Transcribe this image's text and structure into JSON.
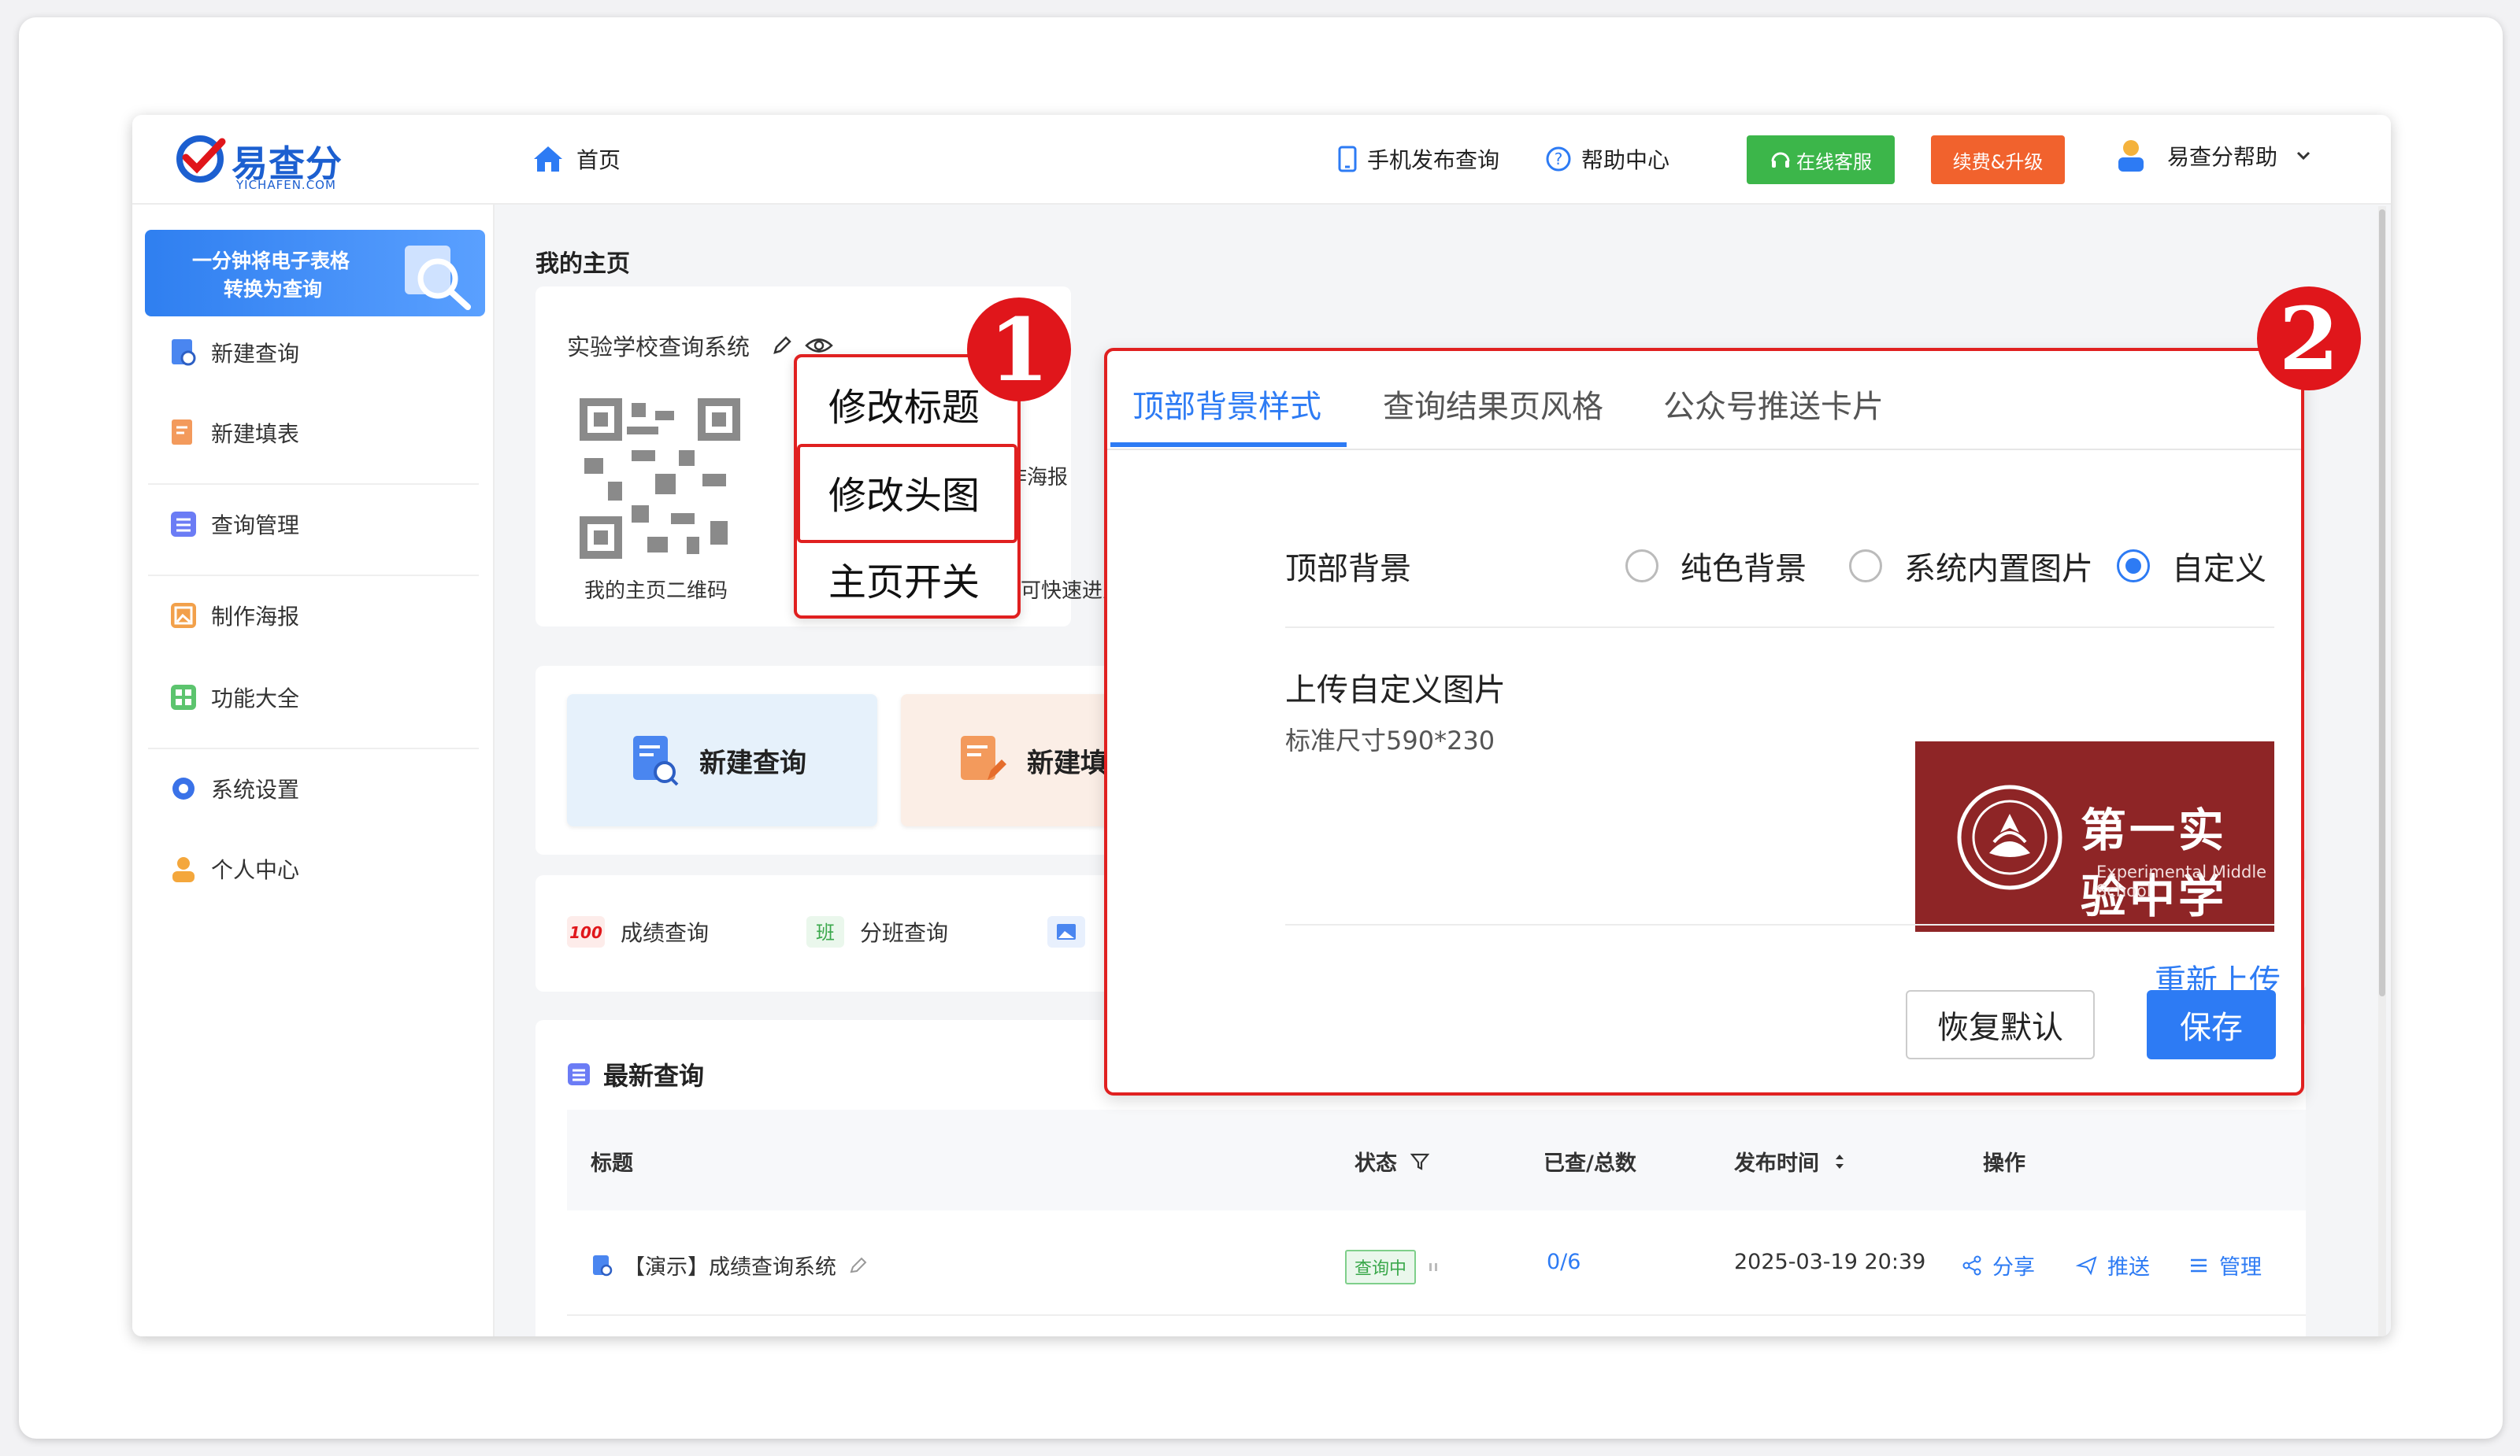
{
  "header": {
    "logo_text": "易查分",
    "logo_sub": "YICHAFEN.COM",
    "home": "首页",
    "mobile_publish": "手机发布查询",
    "help_center": "帮助中心",
    "online_service": "在线客服",
    "renew_upgrade": "续费&升级",
    "user_name": "易查分帮助"
  },
  "sidebar": {
    "banner_line1": "一分钟将电子表格",
    "banner_line2": "转换为查询",
    "items": [
      {
        "label": "新建查询"
      },
      {
        "label": "新建填表"
      },
      {
        "label": "查询管理"
      },
      {
        "label": "制作海报"
      },
      {
        "label": "功能大全"
      },
      {
        "label": "系统设置"
      },
      {
        "label": "个人中心"
      }
    ]
  },
  "main": {
    "page_title": "我的主页",
    "homepage_title": "实验学校查询系统",
    "qr_caption": "我的主页二维码",
    "partial_poster": "作海报",
    "partial_quick": "可快速进入",
    "quick_new_query": "新建查询",
    "quick_new_form": "新建填",
    "features": [
      {
        "label": "成绩查询"
      },
      {
        "label": "分班查询"
      }
    ],
    "latest_title": "最新查询",
    "table": {
      "headers": [
        "标题",
        "状态",
        "已查/总数",
        "发布时间",
        "操作"
      ],
      "rows": [
        {
          "title": "【演示】成绩查询系统",
          "status": "查询中",
          "count": "0/6",
          "time": "2025-03-19 20:39",
          "share": "分享",
          "push": "推送",
          "manage": "管理"
        }
      ]
    }
  },
  "menu": {
    "badge": "1",
    "items": [
      "修改标题",
      "修改头图",
      "主页开关"
    ]
  },
  "panel": {
    "badge": "2",
    "tabs": [
      "顶部背景样式",
      "查询结果页风格",
      "公众号推送卡片"
    ],
    "bg_label": "顶部背景",
    "radios": [
      {
        "label": "纯色背景",
        "checked": false
      },
      {
        "label": "系统内置图片",
        "checked": false
      },
      {
        "label": "自定义",
        "checked": true
      }
    ],
    "upload_label": "上传自定义图片",
    "size_hint": "标准尺寸590*230",
    "school_name": "第一实验中学",
    "school_en": "Experimental Middle School",
    "reupload": "重新上传",
    "reset_btn": "恢复默认",
    "save_btn": "保存"
  },
  "colors": {
    "accent": "#2d7bf4",
    "highlight_red": "#e02020",
    "green": "#3cb64a",
    "orange": "#f1622d",
    "school_bg": "#8e2526"
  }
}
